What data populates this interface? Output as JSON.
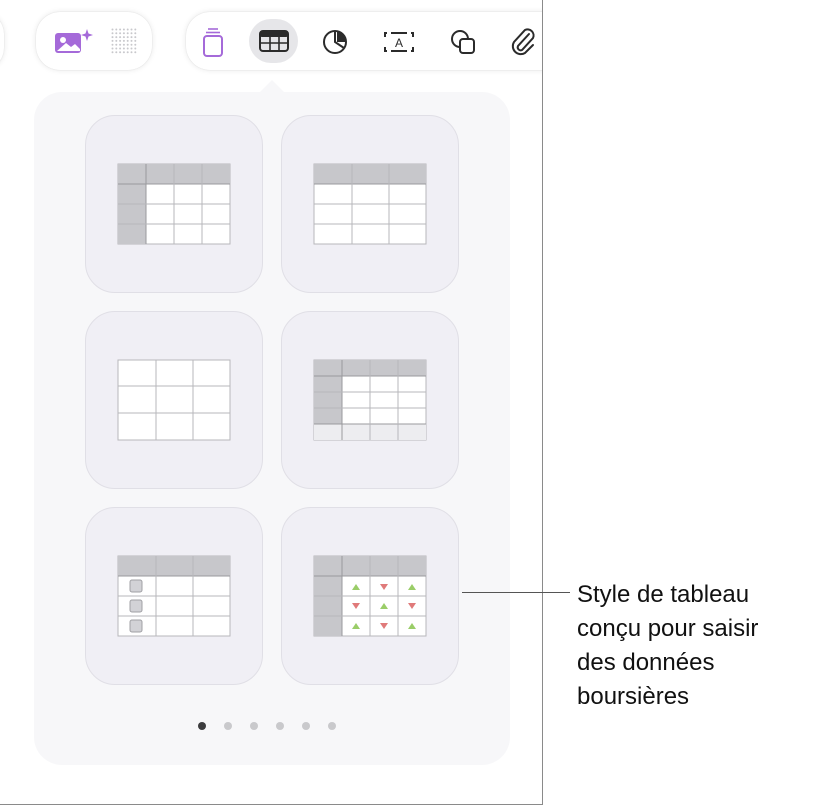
{
  "toolbar": {
    "left_group": [
      {
        "icon": "image-sparkle-icon",
        "color": "#a56ad9"
      },
      {
        "icon": "dot-grid-icon",
        "color": "#c8c8cc"
      }
    ],
    "main_group": [
      {
        "icon": "shapes-stack-icon",
        "color": "#a56ad9"
      },
      {
        "icon": "table-icon",
        "color": "#2b2b2b",
        "selected": true
      },
      {
        "icon": "pie-chart-icon",
        "color": "#2b2b2b"
      },
      {
        "icon": "text-box-icon",
        "color": "#2b2b2b",
        "glyph": "A"
      },
      {
        "icon": "shapes-icon",
        "color": "#2b2b2b"
      },
      {
        "icon": "paperclip-icon",
        "color": "#2b2b2b"
      }
    ]
  },
  "table_styles": [
    {
      "name": "header-row-and-column"
    },
    {
      "name": "header-row"
    },
    {
      "name": "plain"
    },
    {
      "name": "header-row-column-footer"
    },
    {
      "name": "checklist"
    },
    {
      "name": "stock"
    }
  ],
  "page_indicator": {
    "count": 6,
    "current": 1
  },
  "callout": {
    "text": "Style de tableau\nconçu pour saisir\ndes données\nboursières"
  },
  "colors": {
    "accent_purple": "#a56ad9",
    "up_arrow": "#9acd68",
    "down_arrow": "#e07a7a"
  }
}
